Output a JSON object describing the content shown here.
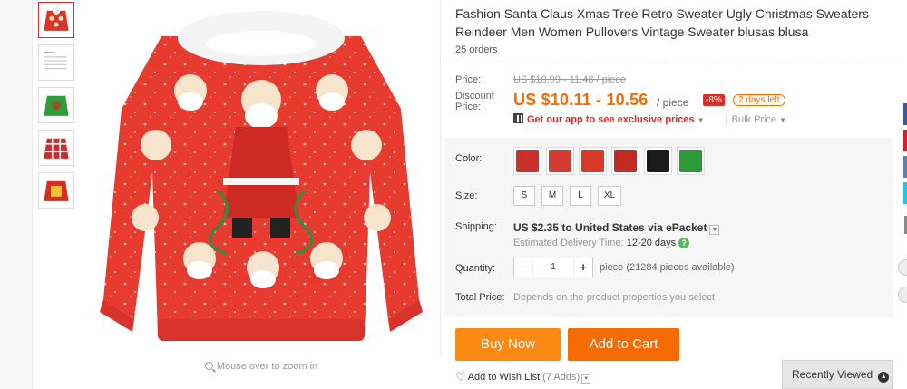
{
  "product": {
    "title": "Fashion Santa Claus Xmas Tree Retro Sweater Ugly Christmas Sweaters Reindeer Men Women Pullovers Vintage Sweater blusas blusa",
    "orders": "25 orders"
  },
  "gallery": {
    "zoom_hint": "Mouse over to zoom in",
    "thumbs": [
      {
        "name": "santa-sweater",
        "color": "#d9362a"
      },
      {
        "name": "size-chart",
        "color": "#eeeeee"
      },
      {
        "name": "reindeer-green-sweater",
        "color": "#2f9e3a"
      },
      {
        "name": "plaid-red-sweater",
        "color": "#c62d2d"
      },
      {
        "name": "red-yellow-sweater",
        "color": "#d92d20"
      }
    ]
  },
  "price": {
    "label": "Price:",
    "original": "US $10.99 - 11.48 / piece",
    "discount_label": "Discount Price:",
    "discount": "US $10.11 - 10.56",
    "unit": "/ piece",
    "percent_off": "-8%",
    "time_left": "2 days left",
    "app_link": "Get our app to see exclusive prices",
    "bulk": "Bulk Price"
  },
  "options": {
    "color_label": "Color:",
    "colors": [
      "#c8322a",
      "#d43b33",
      "#d83a2a",
      "#c22b24",
      "#1b1b1b",
      "#2c9a36"
    ],
    "size_label": "Size:",
    "sizes": [
      "S",
      "M",
      "L",
      "XL"
    ]
  },
  "shipping": {
    "label": "Shipping:",
    "cost": "US $2.35",
    "to": "to United States via ePacket",
    "estimate_label": "Estimated Delivery Time:",
    "estimate": "12-20 days"
  },
  "quantity": {
    "label": "Quantity:",
    "value": "1",
    "available": "piece (21284 pieces available)"
  },
  "total": {
    "label": "Total Price:",
    "value": "Depends on the product properties you select"
  },
  "actions": {
    "buy_now": "Buy Now",
    "add_to_cart": "Add to Cart",
    "wishlist": "Add to Wish List",
    "wishlist_count": "(7 Adds)"
  },
  "recently_viewed": "Recently Viewed",
  "colors": {
    "accent": "#f66b00",
    "buy_now": "#fa8a14",
    "add_to_cart": "#f66b00",
    "discount_badge": "#e02b27"
  }
}
